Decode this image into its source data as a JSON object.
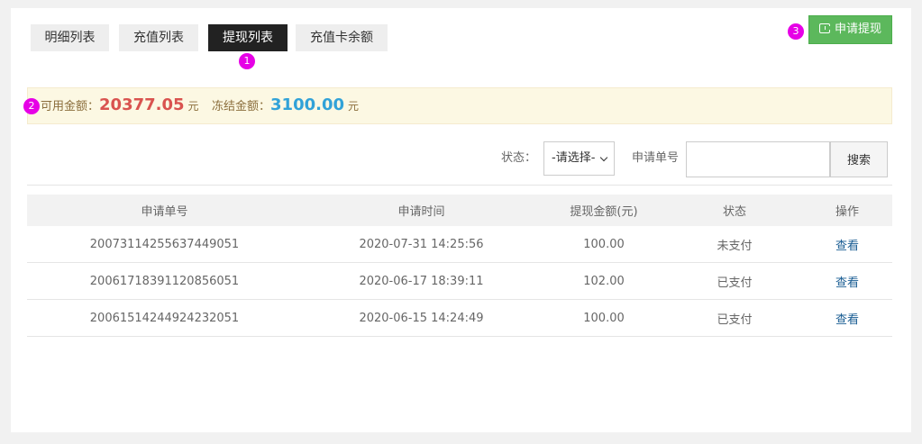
{
  "tabs": [
    {
      "label": "明细列表",
      "active": false
    },
    {
      "label": "充值列表",
      "active": false
    },
    {
      "label": "提现列表",
      "active": true
    },
    {
      "label": "充值卡余额",
      "active": false
    }
  ],
  "markers": [
    "1",
    "2",
    "3"
  ],
  "apply_button": {
    "label": "申请提现",
    "icon": "withdraw-icon",
    "color": "#5cb85c"
  },
  "balance": {
    "available_label": "可用金额：",
    "available_value": "20377.05",
    "frozen_label": "冻结金额：",
    "frozen_value": "3100.00",
    "unit": "元"
  },
  "filter": {
    "status_label": "状态：",
    "status_selected": "-请选择-",
    "order_label": "申请单号",
    "order_value": "",
    "search_label": "搜索"
  },
  "table": {
    "headers": [
      "申请单号",
      "申请时间",
      "提现金额(元)",
      "状态",
      "操作"
    ],
    "rows": [
      {
        "id": "20073114255637449051",
        "time": "2020-07-31 14:25:56",
        "amount": "100.00",
        "status": "未支付",
        "action": "查看"
      },
      {
        "id": "20061718391120856051",
        "time": "2020-06-17 18:39:11",
        "amount": "102.00",
        "status": "已支付",
        "action": "查看"
      },
      {
        "id": "20061514244924232051",
        "time": "2020-06-15 14:24:49",
        "amount": "100.00",
        "status": "已支付",
        "action": "查看"
      }
    ]
  }
}
